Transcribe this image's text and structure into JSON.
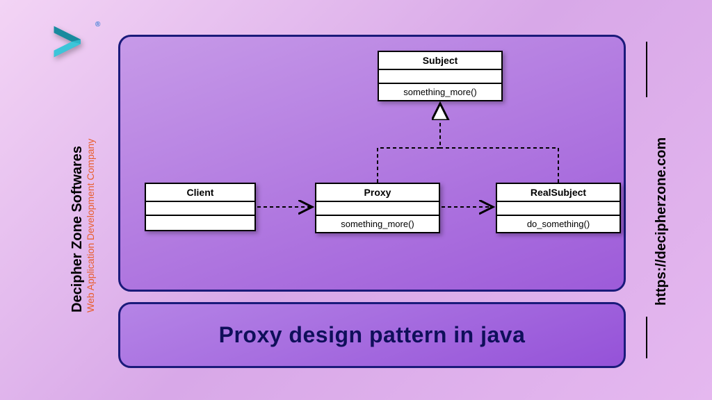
{
  "company": {
    "name": "Decipher Zone Softwares",
    "tagline": "Web Application Development Company",
    "trademark": "®",
    "url": "https://decipherzone.com"
  },
  "title": "Proxy design pattern in java",
  "uml": {
    "subject": {
      "name": "Subject",
      "method": "something_more()"
    },
    "client": {
      "name": "Client"
    },
    "proxy": {
      "name": "Proxy",
      "method": "something_more()"
    },
    "realsubject": {
      "name": "RealSubject",
      "method": "do_something()"
    }
  }
}
